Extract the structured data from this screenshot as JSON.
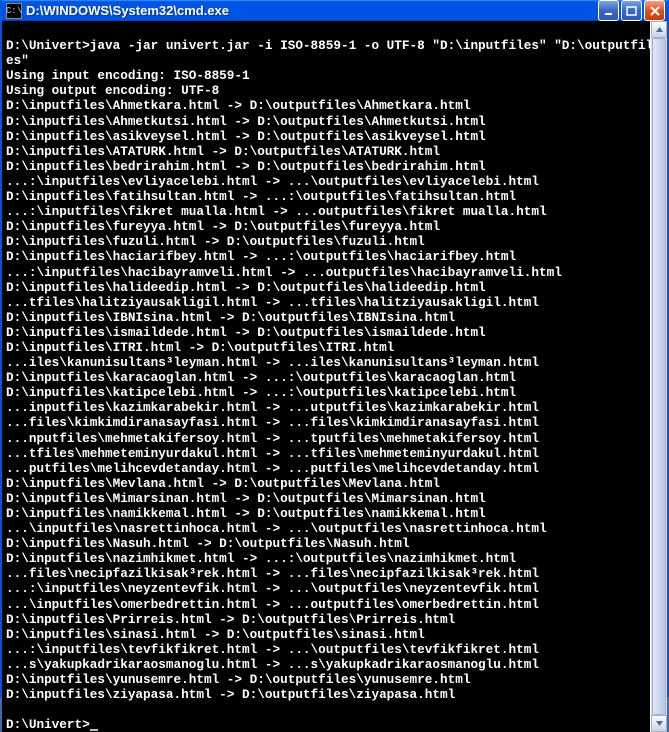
{
  "window": {
    "title": "D:\\WINDOWS\\System32\\cmd.exe",
    "icon_text": "C:\\"
  },
  "terminal": {
    "prompt_path": "D:\\Univert>",
    "command": "java -jar univert.jar -i ISO-8859-1 -o UTF-8 \"D:\\inputfiles\" \"D:\\outputfiles\"",
    "encoding_input_line": "Using input encoding: ISO-8859-1",
    "encoding_output_line": "Using output encoding: UTF-8",
    "conversions": [
      "D:\\inputfiles\\Ahmetkara.html -> D:\\outputfiles\\Ahmetkara.html",
      "D:\\inputfiles\\Ahmetkutsi.html -> D:\\outputfiles\\Ahmetkutsi.html",
      "D:\\inputfiles\\asikveysel.html -> D:\\outputfiles\\asikveysel.html",
      "D:\\inputfiles\\ATATURK.html -> D:\\outputfiles\\ATATURK.html",
      "D:\\inputfiles\\bedrirahim.html -> D:\\outputfiles\\bedrirahim.html",
      "...:\\inputfiles\\evliyacelebi.html -> ...\\outputfiles\\evliyacelebi.html",
      "D:\\inputfiles\\fatihsultan.html -> ...:\\outputfiles\\fatihsultan.html",
      "...:\\inputfiles\\fikret mualla.html -> ...outputfiles\\fikret mualla.html",
      "D:\\inputfiles\\fureyya.html -> D:\\outputfiles\\fureyya.html",
      "D:\\inputfiles\\fuzuli.html -> D:\\outputfiles\\fuzuli.html",
      "D:\\inputfiles\\haciarifbey.html -> ...:\\outputfiles\\haciarifbey.html",
      "...:\\inputfiles\\hacibayramveli.html -> ...outputfiles\\hacibayramveli.html",
      "D:\\inputfiles\\halideedip.html -> D:\\outputfiles\\halideedip.html",
      "...tfiles\\halitziyausakligil.html -> ...tfiles\\halitziyausakligil.html",
      "D:\\inputfiles\\IBNIsina.html -> D:\\outputfiles\\IBNIsina.html",
      "D:\\inputfiles\\ismaildede.html -> D:\\outputfiles\\ismaildede.html",
      "D:\\inputfiles\\ITRI.html -> D:\\outputfiles\\ITRI.html",
      "...iles\\kanunisultans³leyman.html -> ...iles\\kanunisultans³leyman.html",
      "D:\\inputfiles\\karacaoglan.html -> ...:\\outputfiles\\karacaoglan.html",
      "D:\\inputfiles\\katipcelebi.html -> ...:\\outputfiles\\katipcelebi.html",
      "...inputfiles\\kazimkarabekir.html -> ...utputfiles\\kazimkarabekir.html",
      "...files\\kimkimdiranasayfasi.html -> ...files\\kimkimdiranasayfasi.html",
      "...nputfiles\\mehmetakifersoy.html -> ...tputfiles\\mehmetakifersoy.html",
      "...tfiles\\mehmeteminyurdakul.html -> ...tfiles\\mehmeteminyurdakul.html",
      "...putfiles\\melihcevdetanday.html -> ...putfiles\\melihcevdetanday.html",
      "D:\\inputfiles\\Mevlana.html -> D:\\outputfiles\\Mevlana.html",
      "D:\\inputfiles\\Mimarsinan.html -> D:\\outputfiles\\Mimarsinan.html",
      "D:\\inputfiles\\namikkemal.html -> D:\\outputfiles\\namikkemal.html",
      "...\\inputfiles\\nasrettinhoca.html -> ...\\outputfiles\\nasrettinhoca.html",
      "D:\\inputfiles\\Nasuh.html -> D:\\outputfiles\\Nasuh.html",
      "D:\\inputfiles\\nazimhikmet.html -> ...:\\outputfiles\\nazimhikmet.html",
      "...files\\necipfazilkisak³rek.html -> ...files\\necipfazilkisak³rek.html",
      "...:\\inputfiles\\neyzentevfik.html -> ...\\outputfiles\\neyzentevfik.html",
      "...\\inputfiles\\omerbedrettin.html -> ...outputfiles\\omerbedrettin.html",
      "D:\\inputfiles\\Prirreis.html -> D:\\outputfiles\\Prirreis.html",
      "D:\\inputfiles\\sinasi.html -> D:\\outputfiles\\sinasi.html",
      "...:\\inputfiles\\tevfikfikret.html -> ...\\outputfiles\\tevfikfikret.html",
      "...s\\yakupkadrikaraosmanoglu.html -> ...s\\yakupkadrikaraosmanoglu.html",
      "D:\\inputfiles\\yunusemre.html -> D:\\outputfiles\\yunusemre.html",
      "D:\\inputfiles\\ziyapasa.html -> D:\\outputfiles\\ziyapasa.html"
    ],
    "final_prompt": "D:\\Univert>"
  }
}
